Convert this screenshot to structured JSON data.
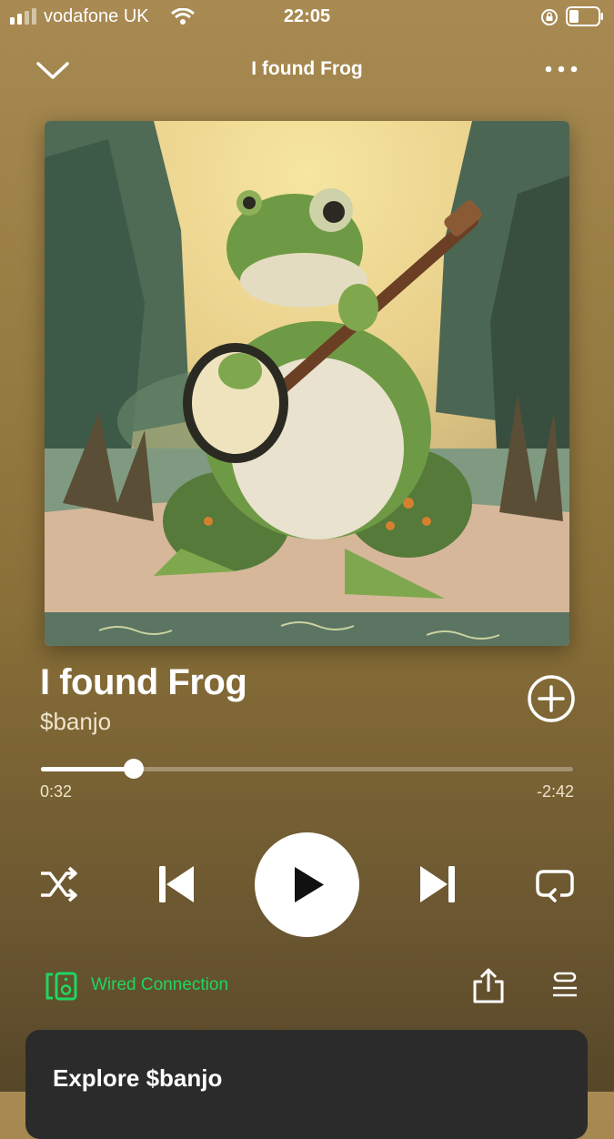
{
  "status_bar": {
    "carrier": "vodafone UK",
    "time": "22:05"
  },
  "header": {
    "title": "I found Frog",
    "collapse_icon": "chevron-down-icon",
    "more_icon": "more-horizontal-icon"
  },
  "track": {
    "title": "I found Frog",
    "artist": "$banjo"
  },
  "progress": {
    "elapsed": "0:32",
    "remaining": "-2:42",
    "fraction": 0.174
  },
  "controls": {
    "shuffle_icon": "shuffle-icon",
    "previous_icon": "skip-previous-icon",
    "play_icon": "play-icon",
    "next_icon": "skip-next-icon",
    "repeat_icon": "repeat-icon"
  },
  "device": {
    "label": "Wired Connection",
    "color": "#1ed760"
  },
  "explore_card": {
    "title": "Explore $banjo"
  }
}
